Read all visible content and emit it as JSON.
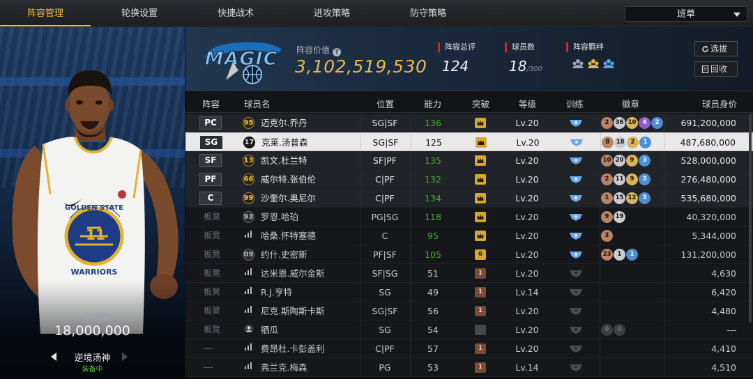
{
  "tabs": [
    "阵容管理",
    "轮换设置",
    "快捷战术",
    "进攻策略",
    "防守策略"
  ],
  "active_tab": 0,
  "team_select": {
    "value": "班草"
  },
  "player_card": {
    "jersey_team": "GOLDEN STATE",
    "jersey_number": "11",
    "jersey_bottom": "WARRIORS",
    "moment_label": "时刻价值",
    "moment_value": "18,000,000",
    "card_name": "逆境汤神",
    "equipped": "装备中"
  },
  "summary": {
    "team_logo_text": "MAGIC",
    "value_label": "阵容价值",
    "value": "3,102,519,530",
    "overall_label": "阵容总评",
    "overall": "124",
    "count_label": "球员数",
    "count": "18",
    "count_max": "/300",
    "bond_label": "阵容羁绊"
  },
  "buttons": {
    "scout": "选拔",
    "recycle": "回收"
  },
  "columns": {
    "lineup": "阵容",
    "name": "球员名",
    "position": "位置",
    "ability": "能力",
    "breakthrough": "突破",
    "level": "等级",
    "training": "训练",
    "badges": "徽章",
    "worth": "球员身价"
  },
  "colors": {
    "accent_gold": "#e8b84a",
    "ability_green": "#3fae2f",
    "equipped_green": "#5fc03c",
    "stat_red": "#c62b2b"
  },
  "rows": [
    {
      "slot": "PC",
      "num": "95",
      "num_style": "gold",
      "name": "迈克尔.乔丹",
      "pos": "SG|SF",
      "ability": "136",
      "green": true,
      "brk": "gold",
      "brk_text": "",
      "level": "Lv.20",
      "train": true,
      "badges": [
        [
          "bronze",
          "2"
        ],
        [
          "silver",
          "36"
        ],
        [
          "gold",
          "10"
        ],
        [
          "purple",
          "4"
        ],
        [
          "blue",
          "2"
        ]
      ],
      "worth": "691,200,000"
    },
    {
      "slot": "SG",
      "num": "17",
      "num_style": "sel",
      "name": "克莱.汤普森",
      "pos": "SG|SF",
      "ability": "125",
      "green": false,
      "brk": "gold",
      "brk_text": "",
      "level": "Lv.20",
      "train": true,
      "badges": [
        [
          "bronze",
          "8"
        ],
        [
          "silver",
          "18"
        ],
        [
          "gold",
          "2"
        ],
        [
          "blue",
          "1"
        ]
      ],
      "worth": "487,680,000",
      "selected": true
    },
    {
      "slot": "SF",
      "num": "13",
      "num_style": "gold",
      "name": "凯文.杜兰特",
      "pos": "SF|PF",
      "ability": "135",
      "green": true,
      "brk": "gold",
      "brk_text": "",
      "level": "Lv.20",
      "train": true,
      "badges": [
        [
          "bronze",
          "10"
        ],
        [
          "silver",
          "20"
        ],
        [
          "gold",
          "9"
        ],
        [
          "blue",
          "3"
        ]
      ],
      "worth": "528,000,000"
    },
    {
      "slot": "PF",
      "num": "66",
      "num_style": "gold",
      "name": "威尔特.张伯伦",
      "pos": "C|PF",
      "ability": "132",
      "green": true,
      "brk": "gold",
      "brk_text": "",
      "level": "Lv.20",
      "train": true,
      "badges": [
        [
          "bronze",
          "2"
        ],
        [
          "silver",
          "11"
        ],
        [
          "gold",
          "9"
        ],
        [
          "blue",
          "3"
        ]
      ],
      "worth": "276,480,000"
    },
    {
      "slot": "C",
      "num": "99",
      "num_style": "gold",
      "name": "沙奎尔.奥尼尔",
      "pos": "C|PF",
      "ability": "134",
      "green": true,
      "brk": "gold",
      "brk_text": "",
      "level": "Lv.20",
      "train": true,
      "badges": [
        [
          "bronze",
          "1"
        ],
        [
          "silver",
          "15"
        ],
        [
          "gold",
          "12"
        ],
        [
          "blue",
          "3"
        ]
      ],
      "worth": "535,680,000"
    },
    {
      "slot": "板凳",
      "num": "93",
      "num_style": "dark",
      "name": "罗恩.哈珀",
      "pos": "PG|SG",
      "ability": "118",
      "green": true,
      "brk": "gold",
      "brk_text": "",
      "level": "Lv.20",
      "train": true,
      "badges": [
        [
          "bronze",
          "9"
        ],
        [
          "silver",
          "19"
        ]
      ],
      "worth": "40,320,000"
    },
    {
      "slot": "板凳",
      "num": "bars",
      "num_style": "bars",
      "name": "哈桑.怀特塞德",
      "pos": "C",
      "ability": "95",
      "green": true,
      "brk": "gold",
      "brk_text": "",
      "level": "Lv.20",
      "train": true,
      "badges": [
        [
          "bronze",
          "3"
        ]
      ],
      "worth": "5,344,000"
    },
    {
      "slot": "板凳",
      "num": "09",
      "num_style": "dark",
      "name": "约什.史密斯",
      "pos": "PF|SF",
      "ability": "105",
      "green": true,
      "brk": "gold",
      "brk_text": "6",
      "level": "Lv.20",
      "train": true,
      "badges": [
        [
          "bronze",
          "23"
        ],
        [
          "silver",
          "1"
        ],
        [
          "blue",
          "1"
        ]
      ],
      "worth": "131,200,000"
    },
    {
      "slot": "板凳",
      "num": "bars",
      "num_style": "bars",
      "name": "达米恩.威尔金斯",
      "pos": "SF|SG",
      "ability": "51",
      "green": false,
      "brk": "bronze",
      "brk_text": "1",
      "level": "Lv.20",
      "train": false,
      "badges": [],
      "worth": "4,630"
    },
    {
      "slot": "板凳",
      "num": "bars",
      "num_style": "bars",
      "name": "R.J.亨特",
      "pos": "SG",
      "ability": "49",
      "green": false,
      "brk": "bronze",
      "brk_text": "1",
      "level": "Lv.14",
      "train": false,
      "badges": [],
      "worth": "6,420"
    },
    {
      "slot": "板凳",
      "num": "bars",
      "num_style": "bars",
      "name": "尼克.斯陶斯卡斯",
      "pos": "SG|SF",
      "ability": "56",
      "green": false,
      "brk": "bronze",
      "brk_text": "1",
      "level": "Lv.20",
      "train": false,
      "badges": [],
      "worth": "4,480"
    },
    {
      "slot": "板凳",
      "num": "person",
      "num_style": "person",
      "name": "牺瓜",
      "pos": "SG",
      "ability": "54",
      "green": false,
      "brk": "grey",
      "brk_text": "",
      "level": "Lv.20",
      "train": false,
      "badges": [
        [
          "empty",
          "0"
        ],
        [
          "empty",
          "0"
        ]
      ],
      "worth": "---"
    },
    {
      "slot": "---",
      "num": "bars",
      "num_style": "bars",
      "name": "费昂杜.卡彭盖利",
      "pos": "C|PF",
      "ability": "57",
      "green": false,
      "brk": "bronze",
      "brk_text": "1",
      "level": "Lv.20",
      "train": false,
      "badges": [],
      "worth": "4,410"
    },
    {
      "slot": "---",
      "num": "bars",
      "num_style": "bars",
      "name": "弗兰克.梅森",
      "pos": "PG",
      "ability": "53",
      "green": false,
      "brk": "bronze",
      "brk_text": "1",
      "level": "Lv.14",
      "train": false,
      "badges": [],
      "worth": "4,510"
    }
  ]
}
